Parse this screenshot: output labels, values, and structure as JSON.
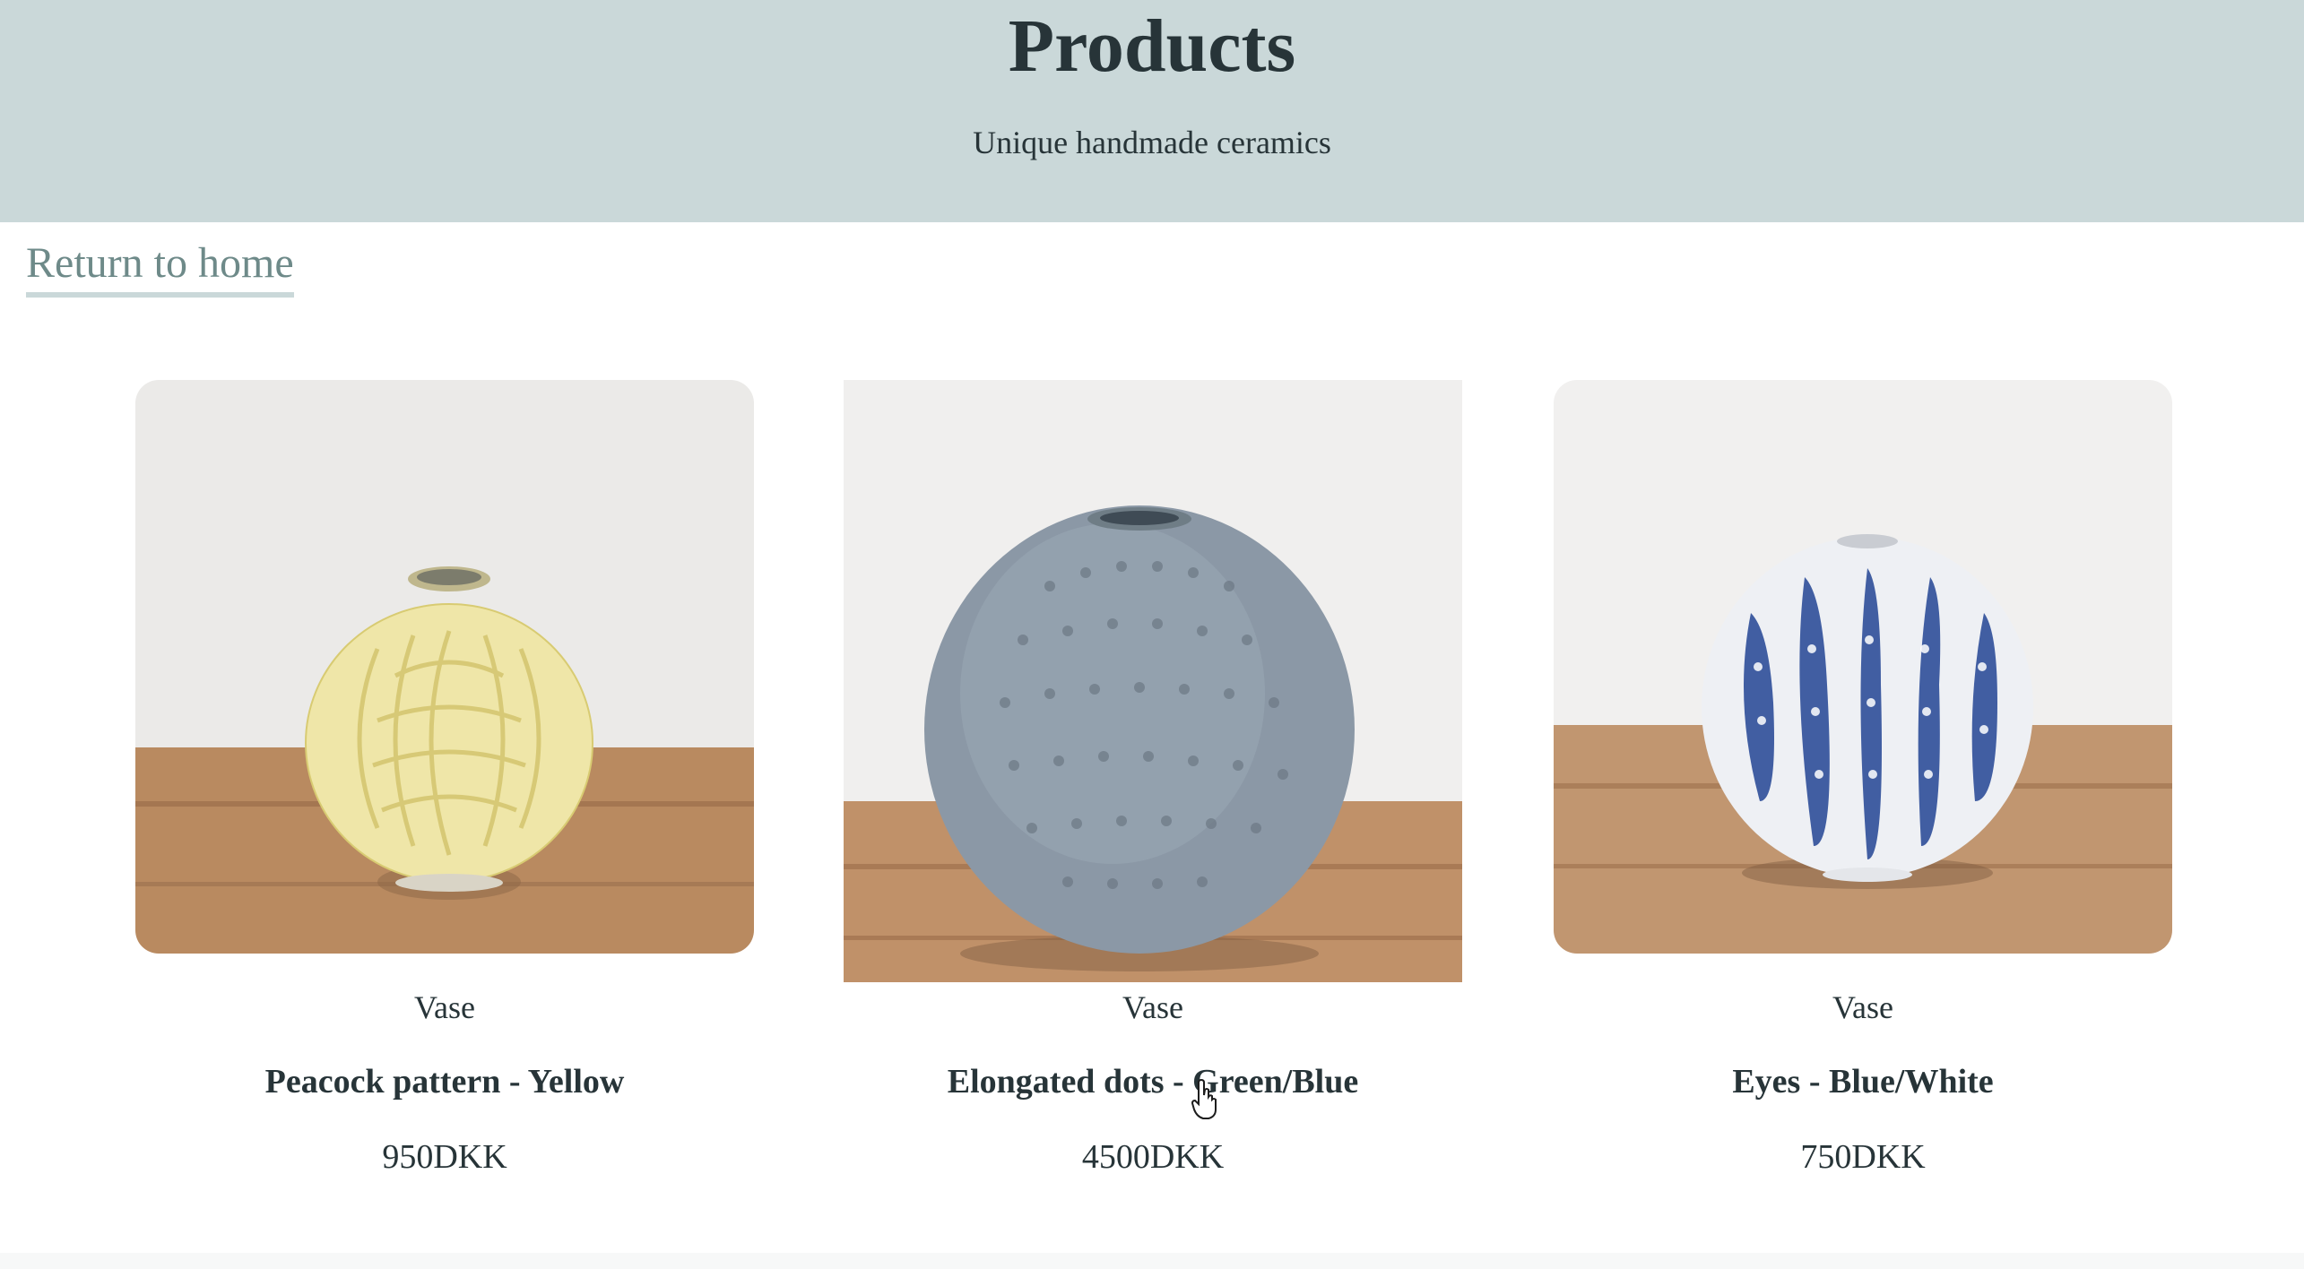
{
  "header": {
    "title": "Products",
    "subtitle": "Unique handmade ceramics"
  },
  "nav": {
    "home_link": "Return to home"
  },
  "products": [
    {
      "type": "Vase",
      "title": "Peacock pattern - Yellow",
      "price": "950DKK",
      "glaze_color": "#efe6a8"
    },
    {
      "type": "Vase",
      "title": "Elongated dots - Green/Blue",
      "price": "4500DKK",
      "glaze_color": "#8b98a6"
    },
    {
      "type": "Vase",
      "title": "Eyes - Blue/White",
      "price": "750DKK",
      "glaze_color": "#2f4f9a"
    }
  ],
  "colors": {
    "header_bg": "#cad8d9",
    "text": "#273438",
    "link": "#6e8a89"
  }
}
